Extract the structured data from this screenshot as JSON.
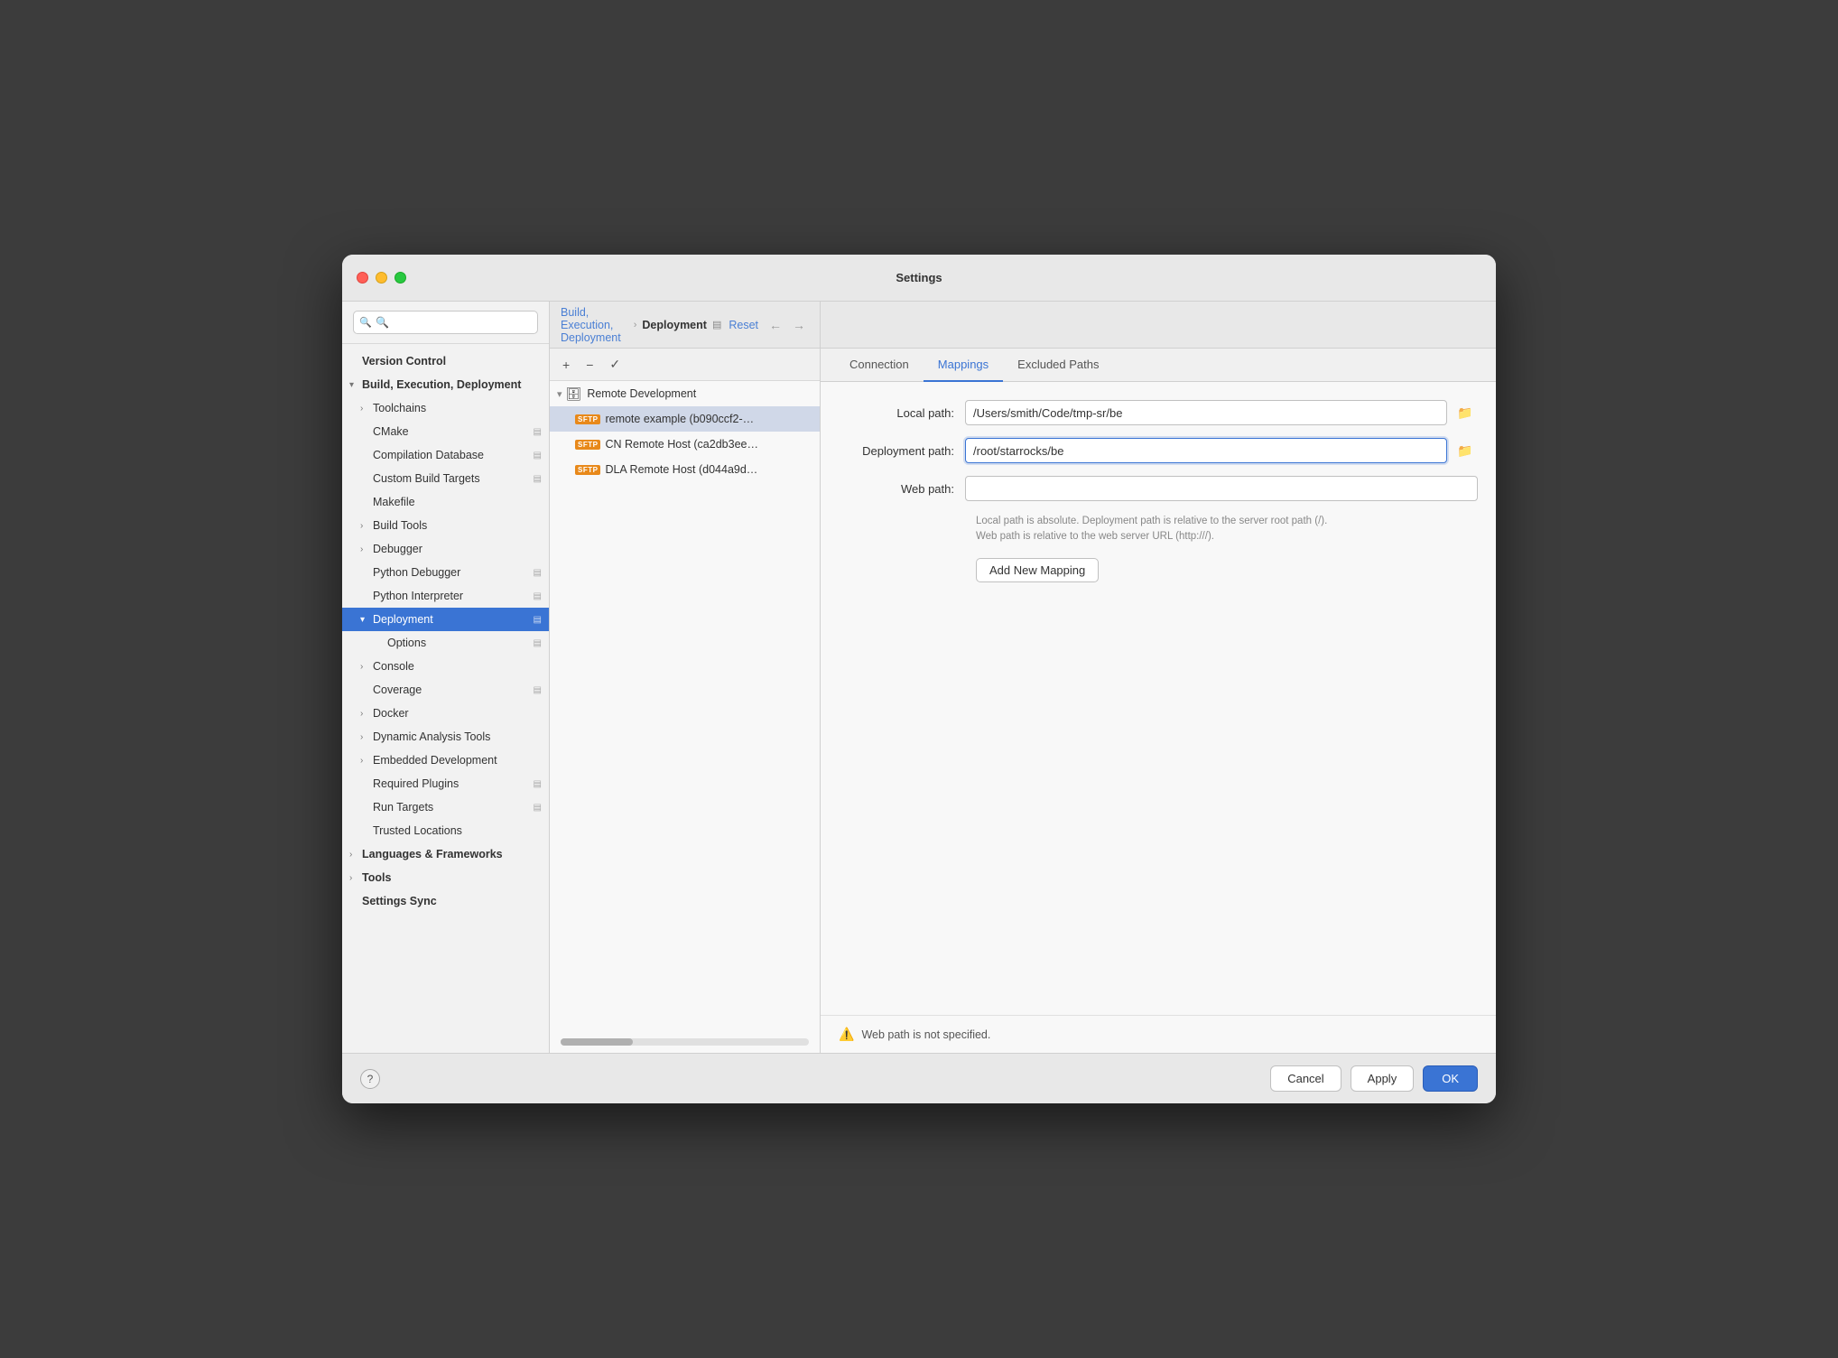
{
  "window": {
    "title": "Settings"
  },
  "header": {
    "breadcrumb_parent": "Build, Execution, Deployment",
    "breadcrumb_separator": "›",
    "breadcrumb_current": "Deployment",
    "reset_label": "Reset",
    "nav_back": "←",
    "nav_forward": "→"
  },
  "search": {
    "placeholder": "🔍"
  },
  "sidebar": {
    "items": [
      {
        "id": "version-control",
        "label": "Version Control",
        "type": "section",
        "indent": 0
      },
      {
        "id": "build-execution-deployment",
        "label": "Build, Execution, Deployment",
        "type": "section-expandable",
        "indent": 0,
        "expanded": true
      },
      {
        "id": "toolchains",
        "label": "Toolchains",
        "type": "expandable",
        "indent": 1
      },
      {
        "id": "cmake",
        "label": "CMake",
        "type": "item-settings",
        "indent": 1
      },
      {
        "id": "compilation-database",
        "label": "Compilation Database",
        "type": "item-settings",
        "indent": 1
      },
      {
        "id": "custom-build-targets",
        "label": "Custom Build Targets",
        "type": "item-settings",
        "indent": 1
      },
      {
        "id": "makefile",
        "label": "Makefile",
        "type": "item",
        "indent": 1
      },
      {
        "id": "build-tools",
        "label": "Build Tools",
        "type": "expandable",
        "indent": 1
      },
      {
        "id": "debugger",
        "label": "Debugger",
        "type": "expandable",
        "indent": 1
      },
      {
        "id": "python-debugger",
        "label": "Python Debugger",
        "type": "item-settings",
        "indent": 1
      },
      {
        "id": "python-interpreter",
        "label": "Python Interpreter",
        "type": "item-settings",
        "indent": 1
      },
      {
        "id": "deployment",
        "label": "Deployment",
        "type": "expandable-selected",
        "indent": 1,
        "expanded": true
      },
      {
        "id": "options",
        "label": "Options",
        "type": "item-settings",
        "indent": 2
      },
      {
        "id": "console",
        "label": "Console",
        "type": "expandable",
        "indent": 1
      },
      {
        "id": "coverage",
        "label": "Coverage",
        "type": "item-settings",
        "indent": 1
      },
      {
        "id": "docker",
        "label": "Docker",
        "type": "expandable",
        "indent": 1
      },
      {
        "id": "dynamic-analysis-tools",
        "label": "Dynamic Analysis Tools",
        "type": "expandable",
        "indent": 1
      },
      {
        "id": "embedded-development",
        "label": "Embedded Development",
        "type": "expandable",
        "indent": 1
      },
      {
        "id": "required-plugins",
        "label": "Required Plugins",
        "type": "item-settings",
        "indent": 1
      },
      {
        "id": "run-targets",
        "label": "Run Targets",
        "type": "item-settings",
        "indent": 1
      },
      {
        "id": "trusted-locations",
        "label": "Trusted Locations",
        "type": "item",
        "indent": 1
      },
      {
        "id": "languages-frameworks",
        "label": "Languages & Frameworks",
        "type": "section-expandable",
        "indent": 0
      },
      {
        "id": "tools",
        "label": "Tools",
        "type": "section-expandable",
        "indent": 0
      },
      {
        "id": "settings-sync",
        "label": "Settings Sync",
        "type": "section",
        "indent": 0
      }
    ]
  },
  "toolbar": {
    "add": "+",
    "remove": "−",
    "apply": "✓"
  },
  "deployment_tree": {
    "header_label": "Remote Development",
    "items": [
      {
        "id": "remote-example",
        "label": "remote example (b090ccf2-…",
        "sftp": true,
        "selected": true
      },
      {
        "id": "cn-remote",
        "label": "CN Remote Host (ca2db3ee…",
        "sftp": true,
        "selected": false
      },
      {
        "id": "dla-remote",
        "label": "DLA Remote Host (d044a9d…",
        "sftp": true,
        "selected": false
      }
    ]
  },
  "tabs": [
    {
      "id": "connection",
      "label": "Connection",
      "active": false
    },
    {
      "id": "mappings",
      "label": "Mappings",
      "active": true
    },
    {
      "id": "excluded-paths",
      "label": "Excluded Paths",
      "active": false
    }
  ],
  "mappings_form": {
    "local_path_label": "Local path:",
    "local_path_value": "/Users/smith/Code/tmp-sr/be",
    "deployment_path_label": "Deployment path:",
    "deployment_path_value": "/root/starrocks/be",
    "web_path_label": "Web path:",
    "web_path_value": "",
    "hint_line1": "Local path is absolute. Deployment path is relative to the server root path (/).",
    "hint_line2": "Web path is relative to the web server URL (http:///).",
    "add_mapping_label": "Add New Mapping"
  },
  "warning": {
    "icon": "⚠️",
    "message": "Web path is not specified."
  },
  "bottom_buttons": {
    "help": "?",
    "cancel": "Cancel",
    "apply": "Apply",
    "ok": "OK"
  }
}
